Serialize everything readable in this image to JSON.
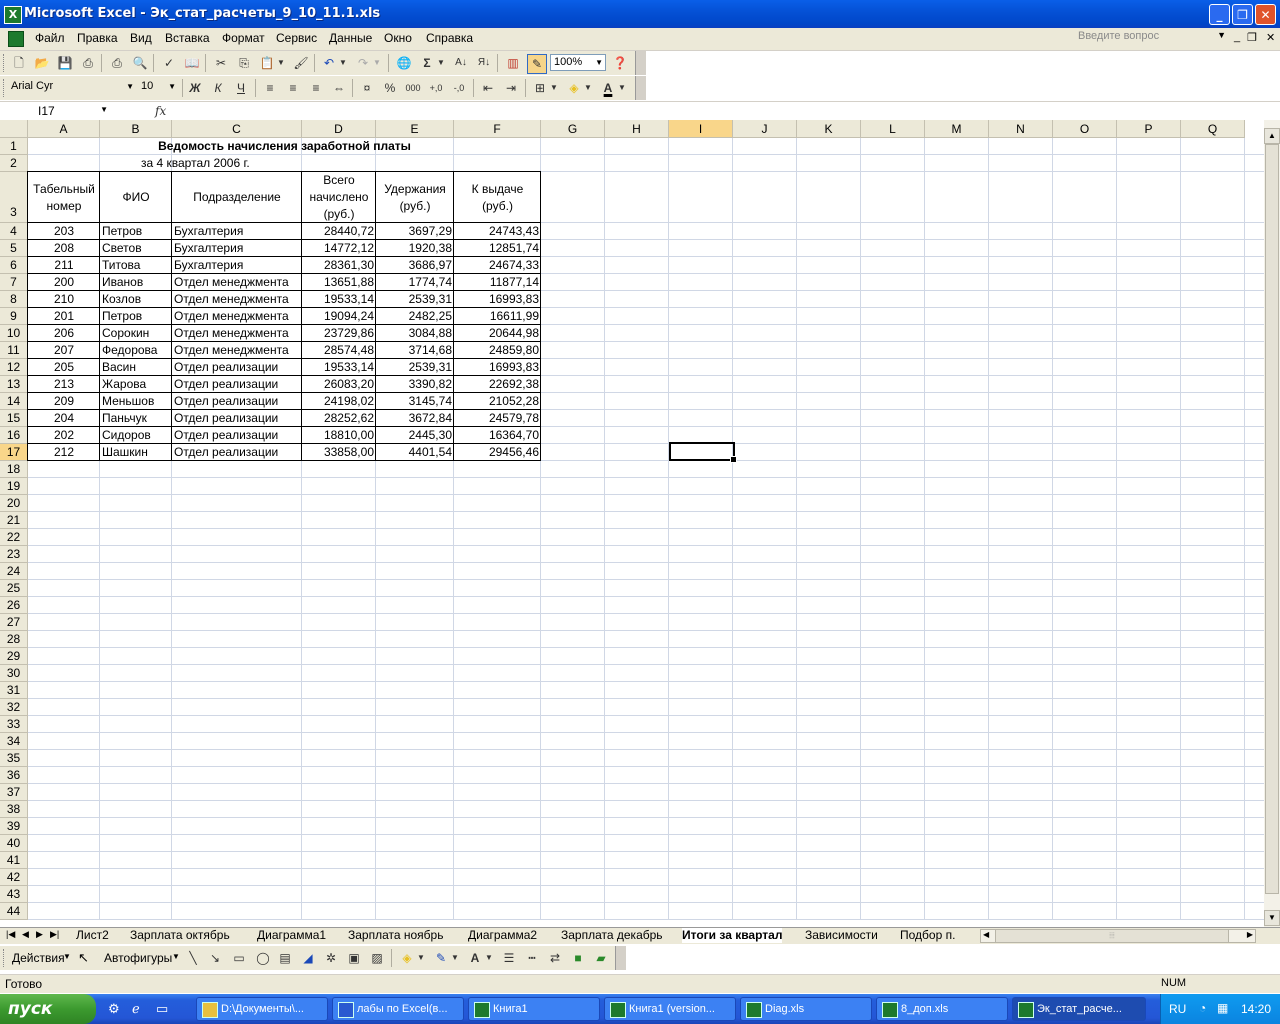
{
  "window": {
    "title": "Microsoft Excel - Эк_стат_расчеты_9_10_11.1.xls",
    "app_icon": "X"
  },
  "menu": [
    "Файл",
    "Правка",
    "Вид",
    "Вставка",
    "Формат",
    "Сервис",
    "Данные",
    "Окно",
    "Справка"
  ],
  "help_placeholder": "Введите вопрос",
  "toolbar": {
    "zoom": "100%",
    "font": "Arial Cyr",
    "size": "10",
    "bold": "Ж",
    "italic": "К",
    "underline": "Ч",
    "sum": "Σ",
    "percent": "%",
    "thousands": "000"
  },
  "namebox": "I17",
  "fx": "fx",
  "columns": [
    "A",
    "B",
    "C",
    "D",
    "E",
    "F",
    "G",
    "H",
    "I",
    "J",
    "K",
    "L",
    "M",
    "N",
    "O",
    "P",
    "Q"
  ],
  "rows": [
    "1",
    "2",
    "3",
    "4",
    "5",
    "6",
    "7",
    "8",
    "9",
    "10",
    "11",
    "12",
    "13",
    "14",
    "15",
    "16",
    "17",
    "18",
    "19",
    "20",
    "21",
    "22",
    "23",
    "24",
    "25",
    "26",
    "27",
    "28",
    "29",
    "30",
    "31",
    "32",
    "33",
    "34",
    "35",
    "36",
    "37",
    "38",
    "39",
    "40",
    "41",
    "42",
    "43",
    "44"
  ],
  "sheet": {
    "title": "Ведомость начисления заработной платы",
    "subtitle": "за 4 квартал 2006 г.",
    "headers": {
      "a": [
        "Табельный",
        "номер"
      ],
      "b": "ФИО",
      "c": "Подразделение",
      "d": [
        "Всего",
        "начислено",
        "(руб.)"
      ],
      "e": [
        "Удержания",
        "(руб.)"
      ],
      "f": [
        "К выдаче",
        "(руб.)"
      ]
    },
    "data": [
      [
        "203",
        "Петров",
        "Бухгалтерия",
        "28440,72",
        "3697,29",
        "24743,43"
      ],
      [
        "208",
        "Светов",
        "Бухгалтерия",
        "14772,12",
        "1920,38",
        "12851,74"
      ],
      [
        "211",
        "Титова",
        "Бухгалтерия",
        "28361,30",
        "3686,97",
        "24674,33"
      ],
      [
        "200",
        "Иванов",
        "Отдел менеджмента",
        "13651,88",
        "1774,74",
        "11877,14"
      ],
      [
        "210",
        "Козлов",
        "Отдел менеджмента",
        "19533,14",
        "2539,31",
        "16993,83"
      ],
      [
        "201",
        "Петров",
        "Отдел менеджмента",
        "19094,24",
        "2482,25",
        "16611,99"
      ],
      [
        "206",
        "Сорокин",
        "Отдел менеджмента",
        "23729,86",
        "3084,88",
        "20644,98"
      ],
      [
        "207",
        "Федорова",
        "Отдел менеджмента",
        "28574,48",
        "3714,68",
        "24859,80"
      ],
      [
        "205",
        "Васин",
        "Отдел реализации",
        "19533,14",
        "2539,31",
        "16993,83"
      ],
      [
        "213",
        "Жарова",
        "Отдел реализации",
        "26083,20",
        "3390,82",
        "22692,38"
      ],
      [
        "209",
        "Меньшов",
        "Отдел реализации",
        "24198,02",
        "3145,74",
        "21052,28"
      ],
      [
        "204",
        "Паньчук",
        "Отдел реализации",
        "28252,62",
        "3672,84",
        "24579,78"
      ],
      [
        "202",
        "Сидоров",
        "Отдел реализации",
        "18810,00",
        "2445,30",
        "16364,70"
      ],
      [
        "212",
        "Шашкин",
        "Отдел реализации",
        "33858,00",
        "4401,54",
        "29456,46"
      ]
    ]
  },
  "tabs": [
    "Лист2",
    "Зарплата октябрь",
    "Диаграмма1",
    "Зарплата ноябрь",
    "Диаграмма2",
    "Зарплата декабрь",
    "Итоги за квартал",
    "Зависимости",
    "Подбор п."
  ],
  "active_tab": "Итоги за квартал",
  "drawbar": {
    "actions": "Действия",
    "autoshapes": "Автофигуры"
  },
  "status": {
    "left": "Готово",
    "num": "NUM"
  },
  "taskbar": {
    "start": "пуск",
    "tasks": [
      "D:\\Документы\\...",
      "лабы по Excel(в...",
      "Книга1",
      "Книга1 (version...",
      "Diag.xls",
      "8_доп.xls",
      "Эк_стат_расче..."
    ],
    "lang": "RU",
    "time": "14:20"
  }
}
